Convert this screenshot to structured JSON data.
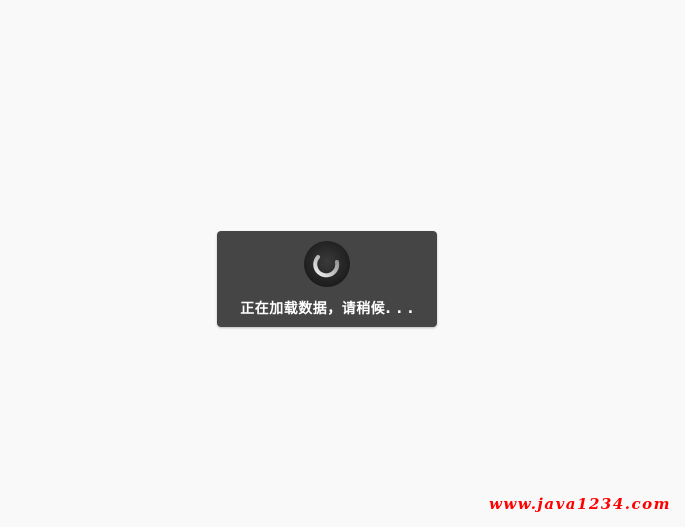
{
  "loading": {
    "message": "正在加载数据，请稍候. . .",
    "spinner_icon": "loading-spinner-icon"
  },
  "watermark": {
    "text": "www.java1234.com",
    "color": "#ff0000"
  },
  "colors": {
    "background": "#f9f9f9",
    "toast_background": "#454545",
    "toast_text": "#ffffff"
  }
}
